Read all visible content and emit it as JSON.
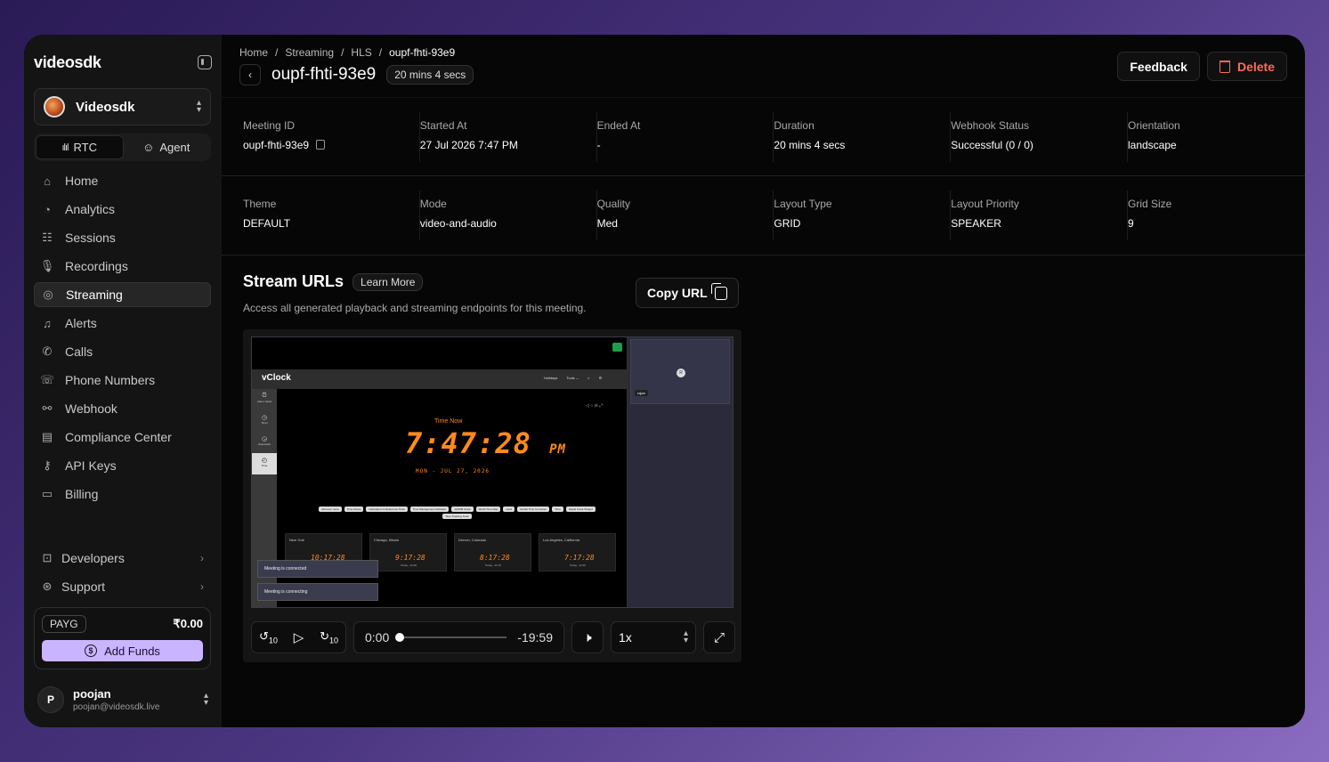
{
  "sidebar": {
    "logo": "videosdk",
    "org_name": "Videosdk",
    "modes": [
      {
        "label": "RTC",
        "icon": "waveform-icon"
      },
      {
        "label": "Agent",
        "icon": "agent-icon"
      }
    ],
    "nav": [
      {
        "label": "Home",
        "icon": "home-icon"
      },
      {
        "label": "Analytics",
        "icon": "pie-chart-icon"
      },
      {
        "label": "Sessions",
        "icon": "list-icon"
      },
      {
        "label": "Recordings",
        "icon": "mic-icon"
      },
      {
        "label": "Streaming",
        "icon": "broadcast-icon",
        "active": true
      },
      {
        "label": "Alerts",
        "icon": "bell-icon"
      },
      {
        "label": "Calls",
        "icon": "phone-icon"
      },
      {
        "label": "Phone Numbers",
        "icon": "phone-numbers-icon"
      },
      {
        "label": "Webhook",
        "icon": "webhook-icon"
      },
      {
        "label": "Compliance Center",
        "icon": "document-icon"
      },
      {
        "label": "API Keys",
        "icon": "key-icon"
      },
      {
        "label": "Billing",
        "icon": "card-icon"
      }
    ],
    "sub_nav": [
      {
        "label": "Developers",
        "icon": "code-icon"
      },
      {
        "label": "Support",
        "icon": "lifebuoy-icon"
      }
    ],
    "plan": {
      "badge": "PAYG",
      "balance": "₹0.00",
      "add_funds": "Add Funds"
    },
    "user": {
      "initial": "P",
      "name": "poojan",
      "email": "poojan@videosdk.live"
    }
  },
  "breadcrumb": [
    "Home",
    "Streaming",
    "HLS",
    "oupf-fhti-93e9"
  ],
  "header": {
    "title": "oupf-fhti-93e9",
    "duration_badge": "20 mins 4 secs",
    "feedback": "Feedback",
    "delete": "Delete"
  },
  "info_row_1": [
    {
      "label": "Meeting ID",
      "value": "oupf-fhti-93e9"
    },
    {
      "label": "Started At",
      "value": "27 Jul 2026 7:47 PM"
    },
    {
      "label": "Ended At",
      "value": "-"
    },
    {
      "label": "Duration",
      "value": "20 mins 4 secs"
    },
    {
      "label": "Webhook Status",
      "value": "Successful (0 / 0)"
    },
    {
      "label": "Orientation",
      "value": "landscape"
    }
  ],
  "info_row_2": [
    {
      "label": "Theme",
      "value": "DEFAULT"
    },
    {
      "label": "Mode",
      "value": "video-and-audio"
    },
    {
      "label": "Quality",
      "value": "Med"
    },
    {
      "label": "Layout Type",
      "value": "GRID"
    },
    {
      "label": "Layout Priority",
      "value": "SPEAKER"
    },
    {
      "label": "Grid Size",
      "value": "9"
    }
  ],
  "stream": {
    "title": "Stream URLs",
    "learn_more": "Learn More",
    "description": "Access all generated playback and streaming endpoints for this meeting.",
    "copy_url": "Copy URL"
  },
  "video": {
    "app_logo": "vClock",
    "nav": [
      "Holidays",
      "Tools ⌄"
    ],
    "time_label": "Time Now",
    "time": "7:47:28",
    "ampm": "PM",
    "date": "MON - JUL 27, 2026",
    "side_items": [
      "Alarm Clock",
      "Timer",
      "Stopwatch",
      "Time"
    ],
    "chips": [
      "Discover more",
      "Time Zones",
      "Calculators & Reference Tools",
      "Time Management Software",
      "AM/PM Clock",
      "World Time Map",
      "clock",
      "Global Time Converter",
      "Time",
      "Digital Clock Widget",
      "Time Tracking Tools"
    ],
    "cities": [
      {
        "name": "New York",
        "time": "10:17:28",
        "sub": ""
      },
      {
        "name": "Chicago, Illinois",
        "time": "9:17:28",
        "sub": "Today, -10:30"
      },
      {
        "name": "Denver, Colorado",
        "time": "8:17:28",
        "sub": "Today, -11:30"
      },
      {
        "name": "Los Angeles, California",
        "time": "7:17:28",
        "sub": "Today, -12:30"
      }
    ],
    "toasts": [
      "Meeting is connected",
      "Meeting is connecting"
    ],
    "participant": {
      "initial": "R",
      "name": "rajan"
    }
  },
  "player": {
    "current": "0:00",
    "remaining": "-19:59",
    "speed": "1x",
    "rewind_seconds": "10",
    "forward_seconds": "10",
    "progress": 0
  }
}
